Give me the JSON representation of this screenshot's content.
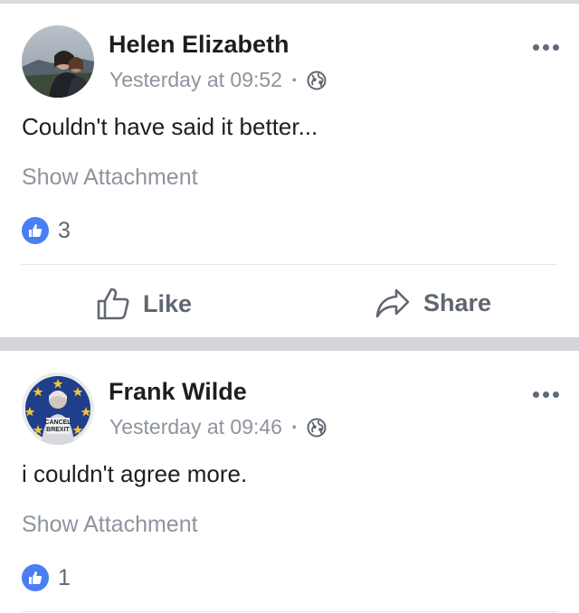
{
  "posts": [
    {
      "author": "Helen Elizabeth",
      "timestamp": "Yesterday at 09:52",
      "separator": "·",
      "privacy_icon": "globe-icon",
      "text": "Couldn't have said it better...",
      "attachment_label": "Show Attachment",
      "like_count": "3",
      "actions": {
        "like": "Like",
        "share": "Share"
      }
    },
    {
      "author": "Frank Wilde",
      "timestamp": "Yesterday at 09:46",
      "separator": "·",
      "privacy_icon": "globe-icon",
      "text": "i couldn't agree more.",
      "attachment_label": "Show Attachment",
      "like_count": "1",
      "avatar_text": "CANCEL BREXIT"
    }
  ],
  "colors": {
    "like_blue": "#4a7ef2",
    "muted_text": "#8d949e",
    "separator_gray": "#d3d5d9"
  }
}
